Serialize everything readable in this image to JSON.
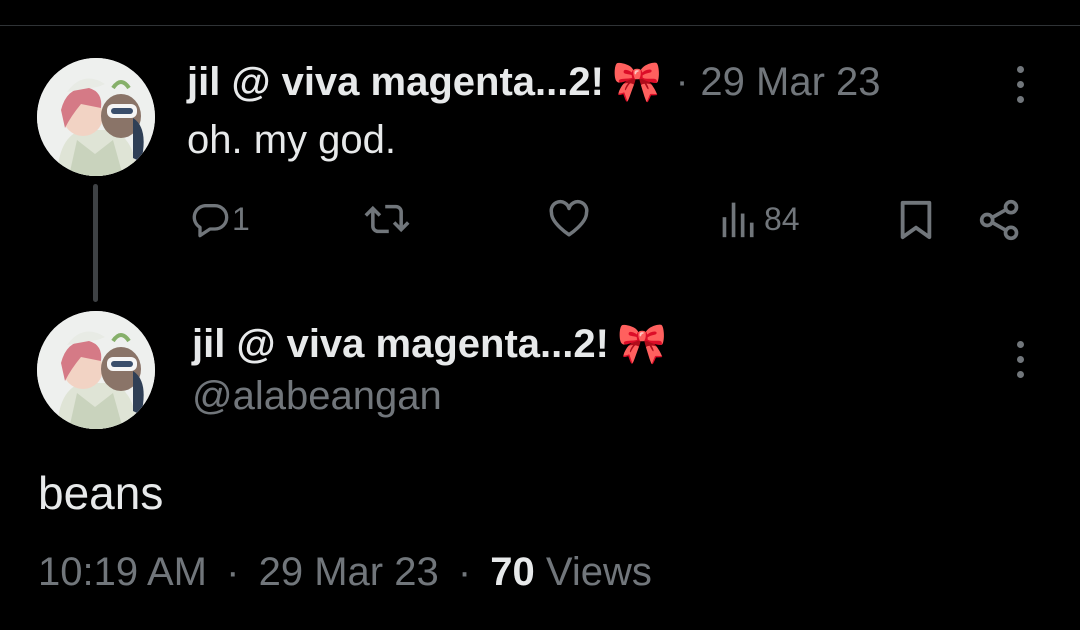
{
  "tweet1": {
    "display_name": "jil @ viva magenta...2!",
    "emoji": "🎀",
    "separator": "·",
    "date": "29 Mar 23",
    "text": "oh. my god.",
    "actions": {
      "reply_count": "1",
      "views_count": "84"
    },
    "icons": [
      "reply-icon",
      "retweet-icon",
      "like-icon",
      "views-icon",
      "bookmark-icon",
      "share-icon",
      "more-icon"
    ]
  },
  "tweet2": {
    "display_name": "jil @ viva magenta...2!",
    "emoji": "🎀",
    "handle": "@alabeangan",
    "text": "beans",
    "time": "10:19 AM",
    "separator": "·",
    "date": "29 Mar 23",
    "views_count": "70",
    "views_label": "Views"
  },
  "colors": {
    "background": "#000000",
    "primary_text": "#e7e9ea",
    "secondary_text": "#71767b",
    "thread_line": "#3e4144"
  }
}
